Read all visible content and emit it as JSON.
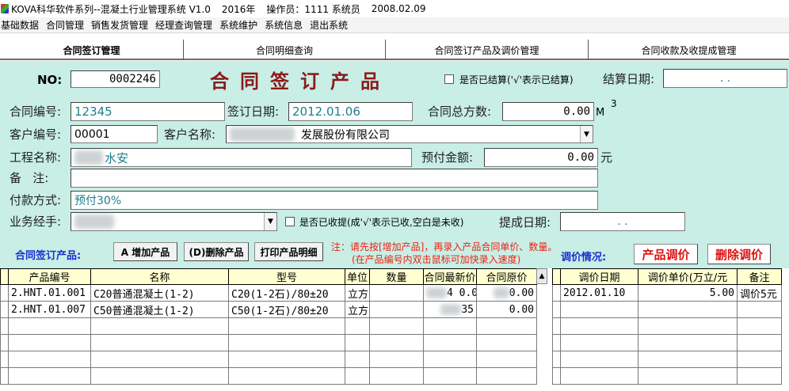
{
  "titlebar": {
    "title": "KOVA科华软件系列--混凝土行业管理系统 V1.0",
    "year": "2016年",
    "operator": "操作员：1111 系统员",
    "date": "2008.02.09"
  },
  "menu": [
    "基础数据",
    "合同管理",
    "销售发货管理",
    "经理查询管理",
    "系统维护",
    "系统信息",
    "退出系统"
  ],
  "tabs": [
    "合同签订管理",
    "合同明细查询",
    "合同签订产品及调价管理",
    "合同收款及收提成管理"
  ],
  "form": {
    "no_label": "NO:",
    "no_value": "0002246",
    "title": "合同签订产品",
    "settled_check_label": "是否已结算('√'表示已结算)",
    "settle_date_label": "结算日期:",
    "settle_date_value": ". .",
    "contract_no_label": "合同编号:",
    "contract_no_value": "12345",
    "sign_date_label": "签订日期:",
    "sign_date_value": "2012.01.06",
    "total_volume_label": "合同总方数:",
    "total_volume_value": "0.00",
    "unit_m": "M",
    "unit_3": "3",
    "customer_no_label": "客户编号:",
    "customer_no_value": "00001",
    "customer_name_label": "客户名称:",
    "customer_name_value": "发展股份有限公司",
    "project_label": "工程名称:",
    "project_value": "水安",
    "prepaid_label": "预付金额:",
    "prepaid_value": "0.00",
    "prepaid_unit": "元",
    "remark_label": "备   注:",
    "remark_value": "",
    "payment_label": "付款方式:",
    "payment_value": "预付30%",
    "manager_label": "业务经手:",
    "manager_value": "",
    "collected_check_label": "是否已收提(成'√'表示已收,空白是未收)",
    "commission_date_label": "提成日期:",
    "commission_date_value": ". ."
  },
  "toolbar": {
    "products_label": "合同签订产品:",
    "add_label": "A 增加产品",
    "delete_label": "(D)删除产品",
    "print_label": "打印产品明细",
    "note_line1": "注：请先按[增加产品]，再录入产品合同单价、数量。",
    "note_line2": "(在产品编号内双击鼠标可加快录入速度)",
    "price_adjust_label": "调价情况:",
    "adjust_btn": "产品调价",
    "delete_adjust_btn": "删除调价"
  },
  "product_table": {
    "headers": [
      "产品编号",
      "名称",
      "型号",
      "单位",
      "数量",
      "合同最新价",
      "合同原价"
    ],
    "rows": [
      [
        "2.HNT.01.001",
        "C20普通混凝土(1-2)",
        "C20(1-2石)/80±20",
        "立方",
        "",
        "4  0.0",
        "0.00"
      ],
      [
        "2.HNT.01.007",
        "C50普通混凝土(1-2)",
        "C50(1-2石)/80±20",
        "立方",
        "",
        "35",
        "0.00"
      ]
    ]
  },
  "adjust_table": {
    "headers": [
      "调价日期",
      "调价单价(万立/元",
      "备注"
    ],
    "rows": [
      [
        "2012.01.10",
        "5.00",
        "调价5元"
      ]
    ]
  }
}
